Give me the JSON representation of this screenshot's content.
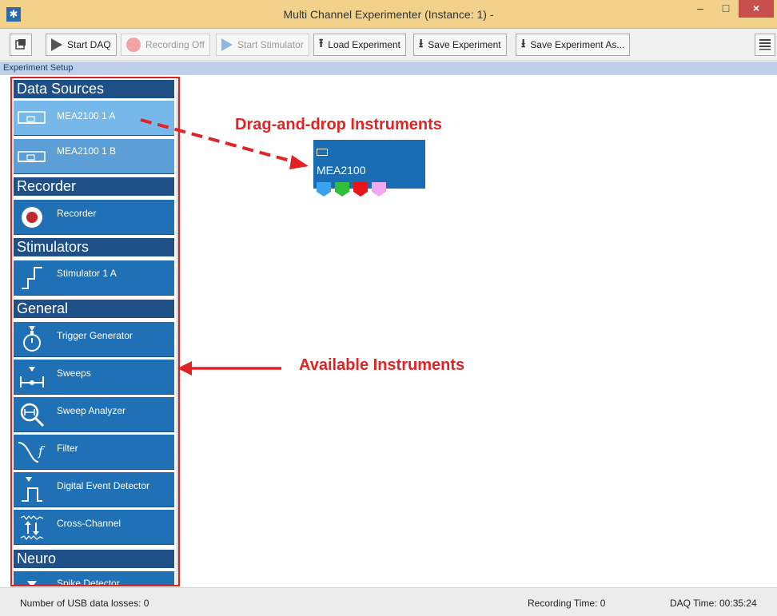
{
  "window": {
    "title": "Multi Channel Experimenter (Instance: 1) -",
    "minimize": "–",
    "maximize": "□",
    "close": "×"
  },
  "toolbar": {
    "start_daq": "Start DAQ",
    "recording_off": "Recording Off",
    "start_stimulator": "Start Stimulator",
    "load_experiment": "Load Experiment",
    "save_experiment": "Save Experiment",
    "save_experiment_as": "Save Experiment As..."
  },
  "setup": {
    "label": "Experiment Setup"
  },
  "panel": {
    "sections": [
      {
        "title": "Data Sources"
      },
      {
        "title": "Recorder"
      },
      {
        "title": "Stimulators"
      },
      {
        "title": "General"
      },
      {
        "title": "Neuro"
      }
    ],
    "items": [
      {
        "label": "MEA2100   1   A",
        "icon": "mea-device-icon"
      },
      {
        "label": "MEA2100   1   B",
        "icon": "mea-device-icon"
      },
      {
        "label": "Recorder",
        "icon": "record-icon"
      },
      {
        "label": "Stimulator   1   A",
        "icon": "stimulator-pulse-icon"
      },
      {
        "label": "Trigger Generator",
        "icon": "stopwatch-icon"
      },
      {
        "label": "Sweeps",
        "icon": "sweeps-icon"
      },
      {
        "label": "Sweep Analyzer",
        "icon": "magnifier-icon"
      },
      {
        "label": "Filter",
        "icon": "filter-curve-icon"
      },
      {
        "label": "Digital Event Detector",
        "icon": "digital-pulse-icon"
      },
      {
        "label": "Cross-Channel",
        "icon": "cross-channel-icon"
      },
      {
        "label": "Spike Detector",
        "icon": "spike-icon"
      }
    ]
  },
  "annotations": {
    "drag": "Drag-and-drop Instruments",
    "available": "Available Instruments"
  },
  "node": {
    "title": "MEA2100",
    "pin_colors": [
      "#3aa3f0",
      "#2fbf3a",
      "#e8141c",
      "#f0a8f0"
    ]
  },
  "status": {
    "usb_losses": "Number of USB data losses:  0",
    "recording_time": "Recording Time:  0",
    "daq_time": "DAQ Time:  00:35:24"
  },
  "colors": {
    "titlebar": "#f2d28a",
    "accent_blue": "#1f70b4",
    "section_blue": "#1e4f86",
    "annotation_red": "#e02424"
  }
}
